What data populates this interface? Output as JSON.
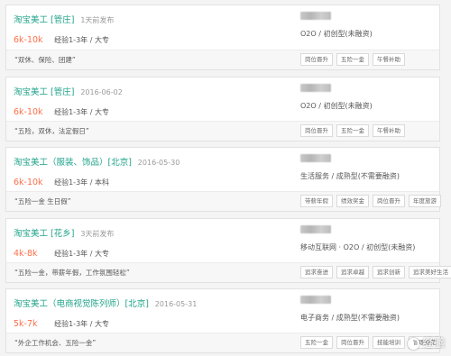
{
  "jobs": [
    {
      "title": "淘宝美工 [管庄]",
      "date": "1天前发布",
      "salary": "6k-10k",
      "requirements": "经验1-3年 / 大专",
      "industry": "O2O / 初创型(未融资)",
      "advantage": "“双休、保险、团建”",
      "tags": [
        "岗位晋升",
        "五险一金",
        "午餐补助"
      ]
    },
    {
      "title": "淘宝美工 [管庄]",
      "date": "2016-06-02",
      "salary": "6k-10k",
      "requirements": "经验1-3年 / 大专",
      "industry": "O2O / 初创型(未融资)",
      "advantage": "“五险，双休，法定假日”",
      "tags": [
        "岗位晋升",
        "五险一金",
        "午餐补助"
      ]
    },
    {
      "title": "淘宝美工（服装、饰品）[北京]",
      "date": "2016-05-30",
      "salary": "6k-10k",
      "requirements": "经验1-3年 / 本科",
      "industry": "生活服务 / 成熟型(不需要融资)",
      "advantage": "“五险一金 生日假”",
      "tags": [
        "带薪年假",
        "绩效奖金",
        "岗位晋升",
        "年度旅游"
      ]
    },
    {
      "title": "淘宝美工 [花乡]",
      "date": "3天前发布",
      "salary": "4k-8k",
      "requirements": "经验1-3年 / 大专",
      "industry": "移动互联网 · O2O / 初创型(未融资)",
      "advantage": "“五险一金，带薪年假，工作氛围轻松”",
      "tags": [
        "追求奋进",
        "追求卓越",
        "追求创新",
        "追求美好生活"
      ]
    },
    {
      "title": "淘宝美工（电商视觉陈列师）[北京]",
      "date": "2016-05-31",
      "salary": "5k-7k",
      "requirements": "经验1-3年 / 大专",
      "industry": "电子商务 / 成熟型(不需要融资)",
      "advantage": "“外企工作机会、五险一金”",
      "tags": [
        "五险一金",
        "岗位晋升",
        "技能培训",
        "管理规范"
      ]
    }
  ],
  "watermark": "经验"
}
